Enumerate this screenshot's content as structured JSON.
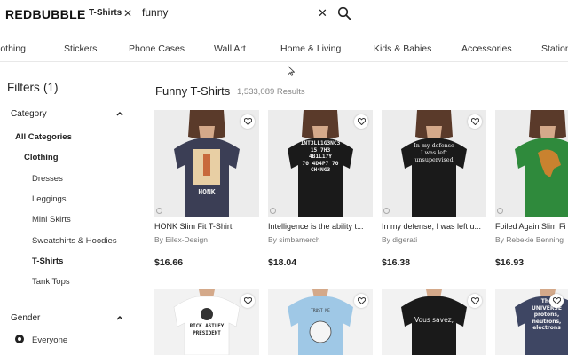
{
  "header": {
    "logo": "REDBUBBLE",
    "filter_chip": "T-Shirts",
    "search_query": "funny"
  },
  "categories": [
    "lothing",
    "Stickers",
    "Phone Cases",
    "Wall Art",
    "Home & Living",
    "Kids & Babies",
    "Accessories",
    "Station"
  ],
  "sidebar": {
    "title": "Filters",
    "count": "(1)",
    "category_heading": "Category",
    "items": [
      "All Categories",
      "Clothing",
      "Dresses",
      "Leggings",
      "Mini Skirts",
      "Sweatshirts & Hoodies",
      "T-Shirts",
      "Tank Tops"
    ],
    "gender_heading": "Gender",
    "gender_option": "Everyone"
  },
  "results": {
    "title": "Funny T-Shirts",
    "count": "1,533,089 Results"
  },
  "products": [
    {
      "title": "HONK Slim Fit T-Shirt",
      "by": "By Eilex-Design",
      "price": "$16.66",
      "shirt_color": "#3b3e55",
      "print": "HONK"
    },
    {
      "title": "Intelligence is the ability t...",
      "by": "By simbamerch",
      "price": "$18.04",
      "shirt_color": "#1a1a1a",
      "print": "1NT3LL1G3NC3\n15 7H3\n4B1L17Y\n70 4D4P7 70\nCH4NG3"
    },
    {
      "title": "In my defense, I was left u...",
      "by": "By digerati",
      "price": "$16.38",
      "shirt_color": "#1a1a1a",
      "print": "In my defense\nI was left\nunsupervised"
    },
    {
      "title": "Foiled Again Slim Fi",
      "by": "By Rebekie Benning",
      "price": "$16.93",
      "shirt_color": "#2f8a3c",
      "print": ""
    }
  ],
  "products_row2": [
    {
      "shirt_color": "#ffffff",
      "print": "RICK ASTLEY\nPRESIDENT"
    },
    {
      "shirt_color": "#9fc8e6",
      "print": "TRUST ME"
    },
    {
      "shirt_color": "#1a1a1a",
      "print": "Vous savez,"
    },
    {
      "shirt_color": "#3e4663",
      "print": "The\nUNIVERSE\nprotons,\nneutrons,\nelectrons"
    }
  ]
}
